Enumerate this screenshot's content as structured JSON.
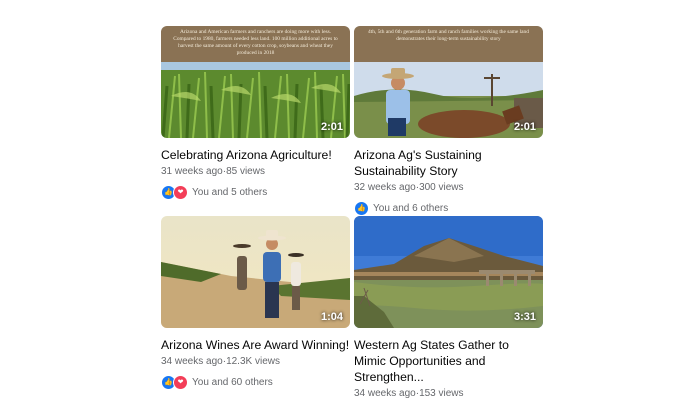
{
  "videos": [
    {
      "banner": "Arizona and American farmers and ranchers are doing more with less. Compared to 1980, farmers needed less land. 100 million additional acres to harvest the same amount of every cotton crop, soybeans and wheat they produced in 2018",
      "duration": "2:01",
      "title": "Celebrating Arizona Agriculture!",
      "age": "31 weeks ago",
      "views": "85 views",
      "reactions": "You and 5 others",
      "reaction_icons": [
        "like-icon",
        "love-icon"
      ]
    },
    {
      "banner": "4th, 5th and 6th generation farm and ranch families working the same land demonstrates their long-term sustainability story",
      "duration": "2:01",
      "title": "Arizona Ag's Sustaining Sustainability Story",
      "age": "32 weeks ago",
      "views": "300 views",
      "reactions": "You and 6 others",
      "reaction_icons": [
        "like-icon"
      ]
    },
    {
      "duration": "1:04",
      "title": "Arizona Wines Are Award Winning!",
      "age": "34 weeks ago",
      "views": "12.3K views",
      "reactions": "You and 60 others",
      "reaction_icons": [
        "like-icon",
        "love-icon"
      ]
    },
    {
      "duration": "3:31",
      "title": "Western Ag States Gather to Mimic Opportunities and Strengthen...",
      "age": "34 weeks ago",
      "views": "153 views",
      "reactions": null,
      "reaction_icons": []
    }
  ],
  "separator": "·",
  "colors": {
    "like": "#1877f2",
    "love": "#f33e58",
    "banner_bg": "#8a7254"
  }
}
